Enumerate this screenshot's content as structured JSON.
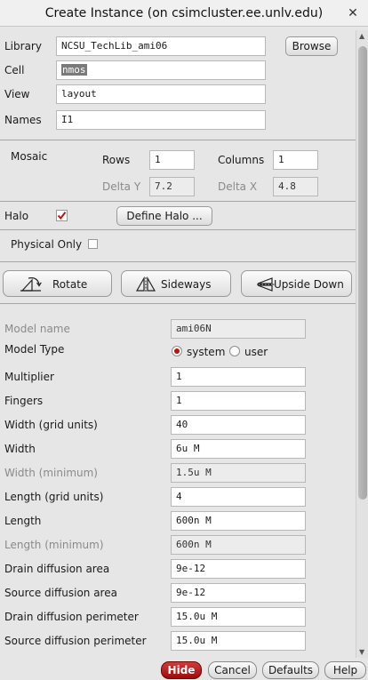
{
  "window": {
    "title": "Create Instance (on csimcluster.ee.unlv.edu)"
  },
  "basic": {
    "library_label": "Library",
    "library_value": "NCSU_TechLib_ami06",
    "browse_label": "Browse",
    "cell_label": "Cell",
    "cell_value": "nmos",
    "view_label": "View",
    "view_value": "layout",
    "names_label": "Names",
    "names_value": "I1"
  },
  "mosaic": {
    "label": "Mosaic",
    "rows_label": "Rows",
    "rows_value": "1",
    "columns_label": "Columns",
    "columns_value": "1",
    "delta_y_label": "Delta Y",
    "delta_y_value": "7.2",
    "delta_x_label": "Delta X",
    "delta_x_value": "4.8"
  },
  "halo": {
    "label": "Halo",
    "checked": true,
    "define_label": "Define Halo ..."
  },
  "physical": {
    "label": "Physical Only",
    "checked": false
  },
  "transform": {
    "rotate": "Rotate",
    "sideways": "Sideways",
    "upside_down": "Upside Down"
  },
  "params": {
    "model_name_label": "Model name",
    "model_name_value": "ami06N",
    "model_type_label": "Model Type",
    "model_type_options": [
      "system",
      "user"
    ],
    "model_type_selected": "system",
    "multiplier_label": "Multiplier",
    "multiplier_value": "1",
    "fingers_label": "Fingers",
    "fingers_value": "1",
    "width_grid_label": "Width (grid units)",
    "width_grid_value": "40",
    "width_label": "Width",
    "width_value": "6u M",
    "width_min_label": "Width (minimum)",
    "width_min_value": "1.5u M",
    "length_grid_label": "Length (grid units)",
    "length_grid_value": "4",
    "length_label": "Length",
    "length_value": "600n M",
    "length_min_label": "Length (minimum)",
    "length_min_value": "600n M",
    "drain_area_label": "Drain diffusion area",
    "drain_area_value": "9e-12",
    "source_area_label": "Source diffusion area",
    "source_area_value": "9e-12",
    "drain_perim_label": "Drain diffusion perimeter",
    "drain_perim_value": "15.0u M",
    "source_perim_label": "Source diffusion perimeter",
    "source_perim_value": "15.0u M"
  },
  "footer": {
    "hide": "Hide",
    "cancel": "Cancel",
    "defaults": "Defaults",
    "help": "Help"
  },
  "colors": {
    "accent": "#c01010",
    "hide_button": "#b01818"
  }
}
